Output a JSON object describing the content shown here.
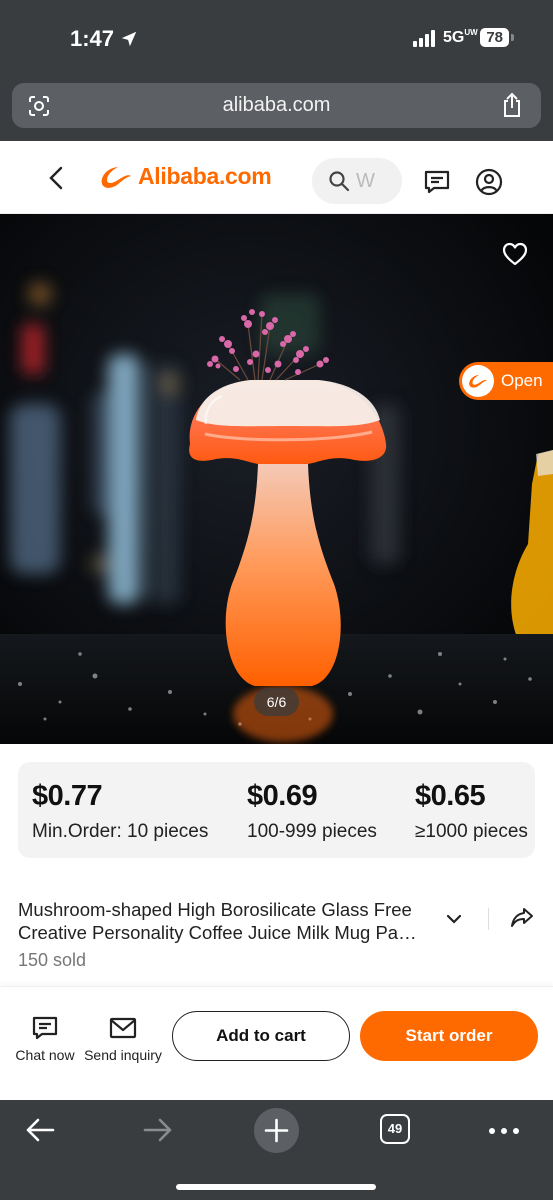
{
  "status_bar": {
    "time": "1:47",
    "network": "5G",
    "network_suffix": "UW",
    "battery": "78"
  },
  "browser": {
    "url": "alibaba.com",
    "open_tabs": "49"
  },
  "header": {
    "logo_text": "Alibaba.com",
    "search_placeholder": "W"
  },
  "gallery": {
    "pager": "6/6",
    "open_app_label": "Open"
  },
  "price_tiers": [
    {
      "price": "$0.77",
      "range": "Min.Order: 10 pieces"
    },
    {
      "price": "$0.69",
      "range": "100-999 pieces"
    },
    {
      "price": "$0.65",
      "range": "≥1000 pieces"
    }
  ],
  "product": {
    "title_line1": "Mushroom-shaped High Borosilicate Glass Free",
    "title_line2": "Creative Personality Coffee Juice Milk Mug Pa…",
    "sold": "150 sold"
  },
  "actions": {
    "chat_label": "Chat now",
    "inquiry_label": "Send inquiry",
    "cart_label": "Add to cart",
    "order_label": "Start order"
  },
  "colors": {
    "brand": "#ff6a00",
    "chrome": "#3a3d40",
    "price_card": "#f3f3f3"
  },
  "icons": [
    "location-arrow-icon",
    "signal-icon",
    "battery-icon",
    "scan-icon",
    "share-icon",
    "back-chevron-icon",
    "alibaba-logo-icon",
    "search-icon",
    "message-icon",
    "user-icon",
    "heart-icon",
    "chevron-down-icon",
    "forward-share-icon",
    "chat-icon",
    "mail-icon",
    "back-arrow-icon",
    "forward-arrow-icon",
    "plus-icon",
    "tabs-icon",
    "more-icon"
  ]
}
